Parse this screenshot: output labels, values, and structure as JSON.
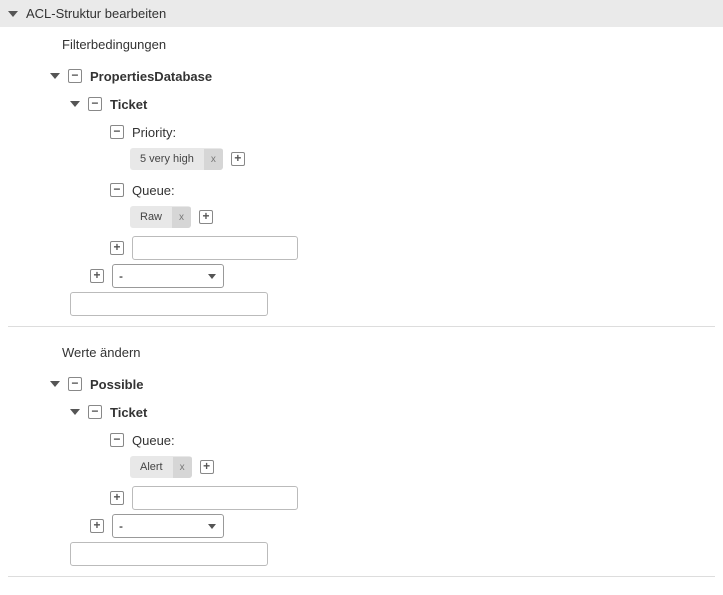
{
  "header": {
    "title": "ACL-Struktur bearbeiten"
  },
  "sections": {
    "match": {
      "title": "Filterbedingungen",
      "root": "PropertiesDatabase",
      "child": "Ticket",
      "props": [
        {
          "label": "Priority:",
          "tag": "5 very high"
        },
        {
          "label": "Queue:",
          "tag": "Raw"
        }
      ],
      "new_prop_input": "",
      "type_select": "-",
      "new_root_input": ""
    },
    "change": {
      "title": "Werte ändern",
      "root": "Possible",
      "child": "Ticket",
      "props": [
        {
          "label": "Queue:",
          "tag": "Alert"
        }
      ],
      "new_prop_input": "",
      "type_select": "-",
      "new_root_input": ""
    }
  },
  "remove_label": "x"
}
